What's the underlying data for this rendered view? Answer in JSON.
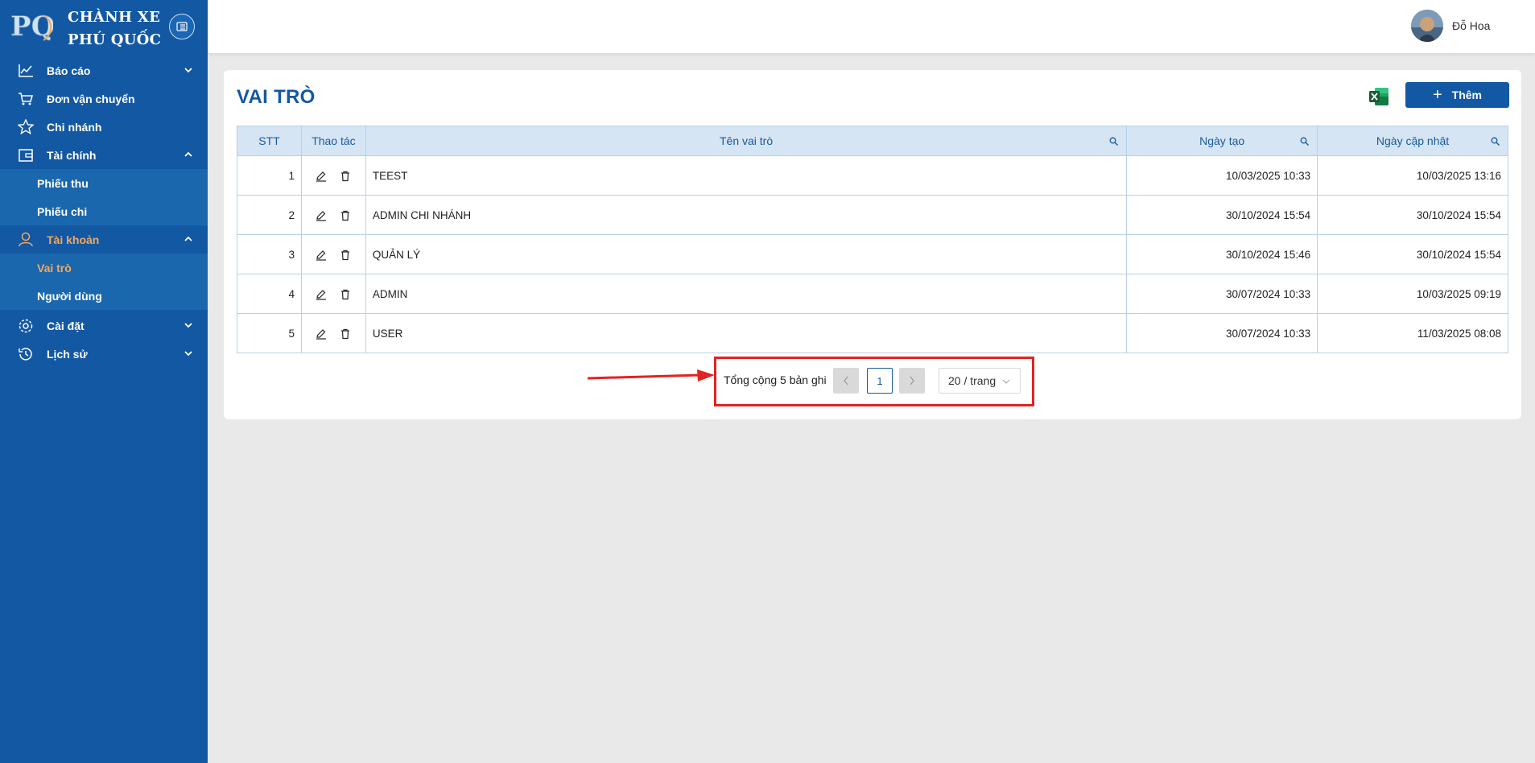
{
  "brand": {
    "logo_text": "PQ",
    "line1": "CHÀNH XE",
    "line2": "PHÚ QUỐC"
  },
  "sidebar": {
    "items": [
      {
        "label": "Báo cáo",
        "icon": "line-chart-icon",
        "chevron": "down"
      },
      {
        "label": "Đơn vận chuyển",
        "icon": "cart-icon"
      },
      {
        "label": "Chi nhánh",
        "icon": "star-icon"
      },
      {
        "label": "Tài chính",
        "icon": "wallet-icon",
        "chevron": "up",
        "children": [
          "Phiếu thu",
          "Phiếu chi"
        ]
      },
      {
        "label": "Tài khoản",
        "icon": "user-icon",
        "chevron": "up",
        "active": true,
        "children": [
          "Vai trò",
          "Người dùng"
        ],
        "active_child": "Vai trò"
      },
      {
        "label": "Cài đặt",
        "icon": "gear-icon",
        "chevron": "down"
      },
      {
        "label": "Lịch sử",
        "icon": "history-icon",
        "chevron": "down"
      }
    ]
  },
  "header": {
    "username": "Đỗ Hoa"
  },
  "page": {
    "title": "VAI TRÒ",
    "add_label": "Thêm"
  },
  "table": {
    "columns": [
      "STT",
      "Thao tác",
      "Tên vai trò",
      "Ngày tạo",
      "Ngày cập nhật"
    ],
    "rows": [
      {
        "stt": "1",
        "name": "TEEST",
        "created": "10/03/2025 10:33",
        "updated": "10/03/2025 13:16"
      },
      {
        "stt": "2",
        "name": "ADMIN CHI NHÁNH",
        "created": "30/10/2024 15:54",
        "updated": "30/10/2024 15:54"
      },
      {
        "stt": "3",
        "name": "QUẢN LÝ",
        "created": "30/10/2024 15:46",
        "updated": "30/10/2024 15:54"
      },
      {
        "stt": "4",
        "name": "ADMIN",
        "created": "30/07/2024 10:33",
        "updated": "10/03/2025 09:19"
      },
      {
        "stt": "5",
        "name": "USER",
        "created": "30/07/2024 10:33",
        "updated": "11/03/2025 08:08"
      }
    ]
  },
  "pagination": {
    "total_text": "Tổng cộng 5 bản ghi",
    "current_page": "1",
    "page_size": "20 / trang"
  },
  "colors": {
    "sidebar": "#1358a3",
    "active": "#f4a85a",
    "highlight": "#e32222"
  }
}
